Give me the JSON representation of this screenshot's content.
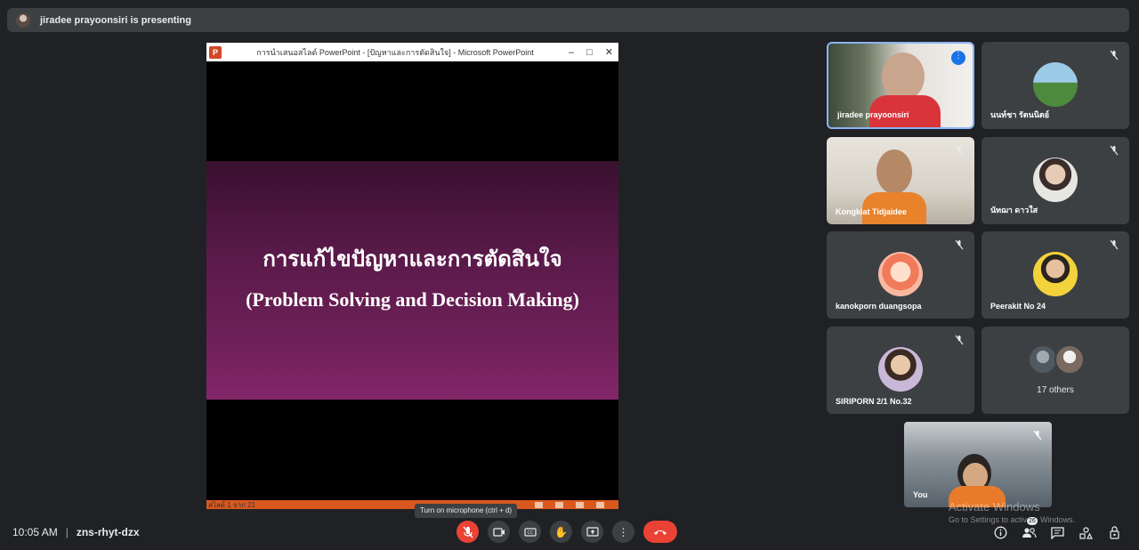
{
  "banner": {
    "text": "jiradee prayoonsiri is presenting"
  },
  "presentation": {
    "window_title": "การนำเสนอสไลด์ PowerPoint - [ปัญหาและการตัดสินใจ] - Microsoft PowerPoint",
    "app_logo": "P",
    "minimize": "–",
    "maximize": "□",
    "close": "✕",
    "slide_title_th": "การแก้ไขปัญหาและการตัดสินใจ",
    "slide_title_en": "(Problem Solving and Decision Making)",
    "status_text": "สไลด์ 1 จาก 21"
  },
  "participants": [
    {
      "name": "jiradee prayoonsiri",
      "dots": "⋮"
    },
    {
      "name": "นนท์ชา รัตนนิตย์"
    },
    {
      "name": "Kongkiat Tidjaidee"
    },
    {
      "name": "นัทฌา ดาวใส"
    },
    {
      "name": "kanokporn duangsopa"
    },
    {
      "name": "Peerakit No 24"
    },
    {
      "name": "SIRIPORN 2/1 No.32"
    },
    {
      "name": "17 others"
    }
  ],
  "self_view": {
    "name": "You"
  },
  "meeting": {
    "time": "10:05 AM",
    "separator": "|",
    "code": "zns-rhyt-dzx"
  },
  "tooltip": "Turn on microphone (ctrl + d)",
  "controls": {
    "mic_icon": "🎤",
    "camera_icon": "▭",
    "captions_icon": "CC",
    "hand_icon": "✋",
    "present_icon": "⬆",
    "more_icon": "⋮",
    "end_icon": "☎"
  },
  "right_icons": {
    "info": "ⓘ",
    "people": "👥",
    "people_count": "26",
    "chat": "💬",
    "activities": "△",
    "host": "🔒"
  },
  "watermark": {
    "line1": "Activate Windows",
    "line2": "Go to Settings to activate Windows."
  },
  "colors": {
    "background": "#202124",
    "tile": "#3c4043",
    "end_call": "#ea4335",
    "active_border": "#8ab4f8"
  }
}
